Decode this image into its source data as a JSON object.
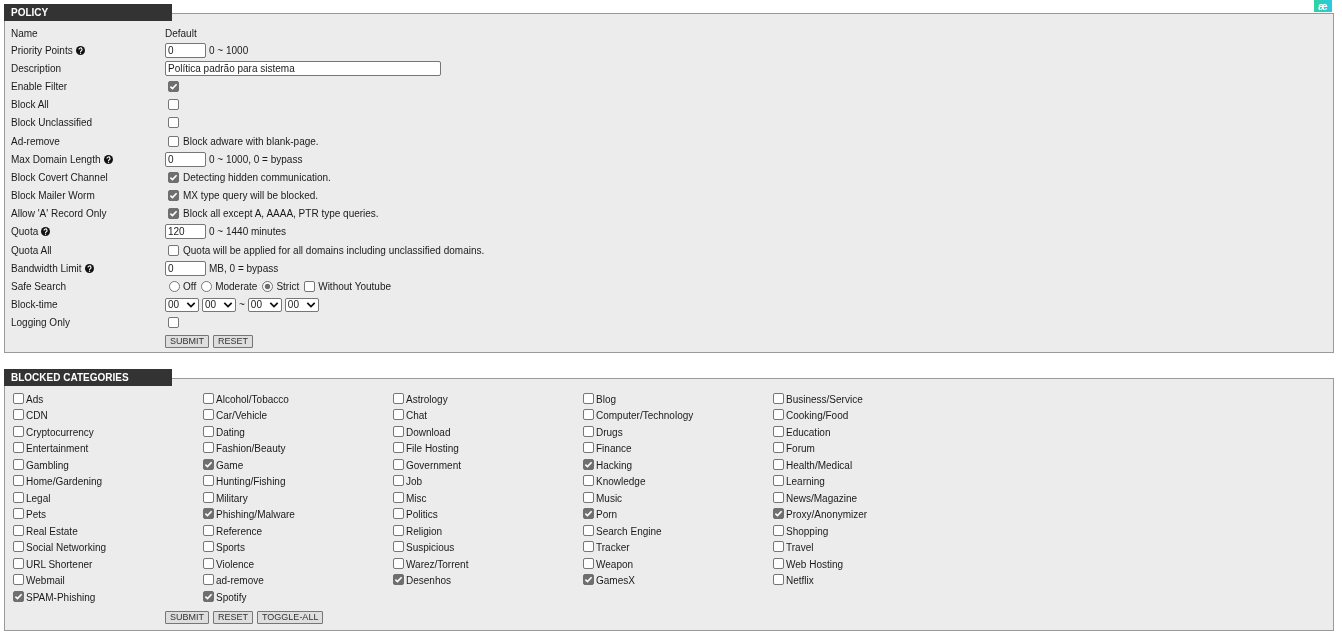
{
  "corner_badge": {
    "text": "æ"
  },
  "policy": {
    "title": "POLICY",
    "rows": [
      {
        "kind": "text",
        "label": "Name",
        "help": false,
        "value": "Default"
      },
      {
        "kind": "number",
        "label": "Priority Points",
        "help": true,
        "value": "0",
        "note": "0 ~ 1000"
      },
      {
        "kind": "textfield",
        "label": "Description",
        "help": false,
        "value": "Política padrão para sistema"
      },
      {
        "kind": "checkbox",
        "label": "Enable Filter",
        "help": false,
        "checked": true
      },
      {
        "kind": "checkbox",
        "label": "Block All",
        "help": false,
        "checked": false
      },
      {
        "kind": "checkbox",
        "label": "Block Unclassified",
        "help": false,
        "checked": false
      },
      {
        "kind": "checkbox",
        "label": "Ad-remove",
        "help": false,
        "checked": false,
        "note": "Block adware with blank-page."
      },
      {
        "kind": "number",
        "label": "Max Domain Length",
        "help": true,
        "value": "0",
        "note": "0 ~ 1000, 0 = bypass"
      },
      {
        "kind": "checkbox",
        "label": "Block Covert Channel",
        "help": false,
        "checked": true,
        "note": "Detecting hidden communication."
      },
      {
        "kind": "checkbox",
        "label": "Block Mailer Worm",
        "help": false,
        "checked": true,
        "note": "MX type query will be blocked."
      },
      {
        "kind": "checkbox",
        "label": "Allow 'A' Record Only",
        "help": false,
        "checked": true,
        "note": "Block all except A, AAAA, PTR type queries."
      },
      {
        "kind": "number",
        "label": "Quota",
        "help": true,
        "value": "120",
        "note": "0 ~ 1440 minutes"
      },
      {
        "kind": "checkbox",
        "label": "Quota All",
        "help": false,
        "checked": false,
        "note": "Quota will be applied for all domains including unclassified domains."
      },
      {
        "kind": "number",
        "label": "Bandwidth Limit",
        "help": true,
        "value": "0",
        "note": "MB, 0 = bypass"
      },
      {
        "kind": "radio",
        "label": "Safe Search",
        "help": false,
        "options": [
          {
            "label": "Off",
            "selected": false
          },
          {
            "label": "Moderate",
            "selected": false
          },
          {
            "label": "Strict",
            "selected": true
          }
        ],
        "extra": {
          "label": "Without Youtube",
          "checked": false
        }
      },
      {
        "kind": "time_range",
        "label": "Block-time",
        "help": false,
        "from": [
          "00",
          "00"
        ],
        "separator": "~",
        "to": [
          "00",
          "00"
        ]
      },
      {
        "kind": "checkbox",
        "label": "Logging Only",
        "help": false,
        "checked": false
      }
    ],
    "buttons": [
      "SUBMIT",
      "RESET"
    ]
  },
  "blocked_categories": {
    "title": "BLOCKED CATEGORIES",
    "items": [
      {
        "label": "Ads",
        "checked": false
      },
      {
        "label": "Alcohol/Tobacco",
        "checked": false
      },
      {
        "label": "Astrology",
        "checked": false
      },
      {
        "label": "Blog",
        "checked": false
      },
      {
        "label": "Business/Service",
        "checked": false
      },
      {
        "label": "CDN",
        "checked": false
      },
      {
        "label": "Car/Vehicle",
        "checked": false
      },
      {
        "label": "Chat",
        "checked": false
      },
      {
        "label": "Computer/Technology",
        "checked": false
      },
      {
        "label": "Cooking/Food",
        "checked": false
      },
      {
        "label": "Cryptocurrency",
        "checked": false
      },
      {
        "label": "Dating",
        "checked": false
      },
      {
        "label": "Download",
        "checked": false
      },
      {
        "label": "Drugs",
        "checked": false
      },
      {
        "label": "Education",
        "checked": false
      },
      {
        "label": "Entertainment",
        "checked": false
      },
      {
        "label": "Fashion/Beauty",
        "checked": false
      },
      {
        "label": "File Hosting",
        "checked": false
      },
      {
        "label": "Finance",
        "checked": false
      },
      {
        "label": "Forum",
        "checked": false
      },
      {
        "label": "Gambling",
        "checked": false
      },
      {
        "label": "Game",
        "checked": true
      },
      {
        "label": "Government",
        "checked": false
      },
      {
        "label": "Hacking",
        "checked": true
      },
      {
        "label": "Health/Medical",
        "checked": false
      },
      {
        "label": "Home/Gardening",
        "checked": false
      },
      {
        "label": "Hunting/Fishing",
        "checked": false
      },
      {
        "label": "Job",
        "checked": false
      },
      {
        "label": "Knowledge",
        "checked": false
      },
      {
        "label": "Learning",
        "checked": false
      },
      {
        "label": "Legal",
        "checked": false
      },
      {
        "label": "Military",
        "checked": false
      },
      {
        "label": "Misc",
        "checked": false
      },
      {
        "label": "Music",
        "checked": false
      },
      {
        "label": "News/Magazine",
        "checked": false
      },
      {
        "label": "Pets",
        "checked": false
      },
      {
        "label": "Phishing/Malware",
        "checked": true
      },
      {
        "label": "Politics",
        "checked": false
      },
      {
        "label": "Porn",
        "checked": true
      },
      {
        "label": "Proxy/Anonymizer",
        "checked": true
      },
      {
        "label": "Real Estate",
        "checked": false
      },
      {
        "label": "Reference",
        "checked": false
      },
      {
        "label": "Religion",
        "checked": false
      },
      {
        "label": "Search Engine",
        "checked": false
      },
      {
        "label": "Shopping",
        "checked": false
      },
      {
        "label": "Social Networking",
        "checked": false
      },
      {
        "label": "Sports",
        "checked": false
      },
      {
        "label": "Suspicious",
        "checked": false
      },
      {
        "label": "Tracker",
        "checked": false
      },
      {
        "label": "Travel",
        "checked": false
      },
      {
        "label": "URL Shortener",
        "checked": false
      },
      {
        "label": "Violence",
        "checked": false
      },
      {
        "label": "Warez/Torrent",
        "checked": false
      },
      {
        "label": "Weapon",
        "checked": false
      },
      {
        "label": "Web Hosting",
        "checked": false
      },
      {
        "label": "Webmail",
        "checked": false
      },
      {
        "label": "ad-remove",
        "checked": false
      },
      {
        "label": "Desenhos",
        "checked": true
      },
      {
        "label": "GamesX",
        "checked": true
      },
      {
        "label": "Netflix",
        "checked": false
      },
      {
        "label": "SPAM-Phishing",
        "checked": true
      },
      {
        "label": "Spotify",
        "checked": true
      }
    ],
    "buttons": [
      "SUBMIT",
      "RESET",
      "TOGGLE-ALL"
    ]
  }
}
